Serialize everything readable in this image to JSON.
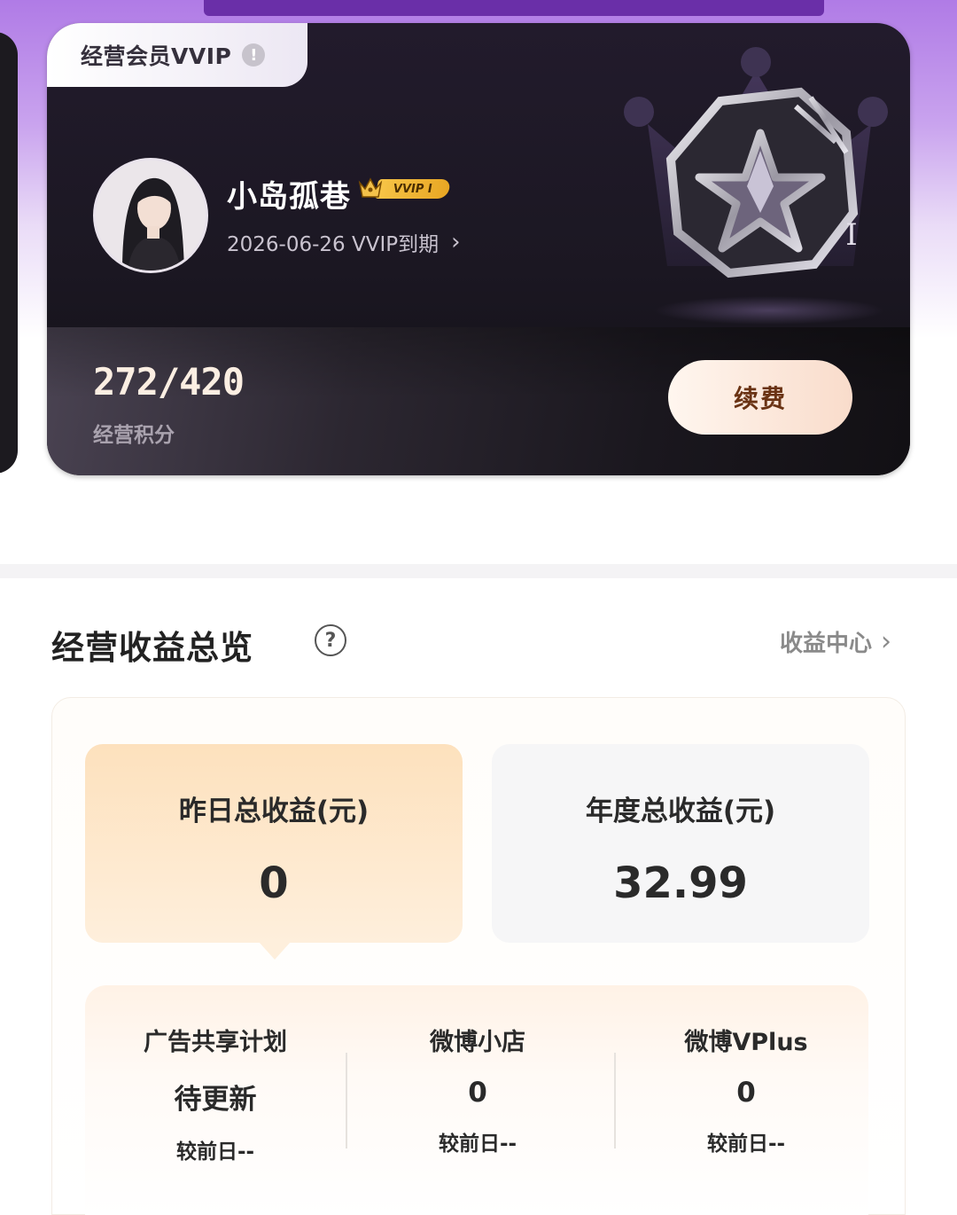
{
  "member_card": {
    "tier_label": "经营会员VVIP",
    "info_icon_glyph": "!",
    "user_name": "小岛孤巷",
    "badge_text": "VVIP I",
    "expiry_text": "2026-06-26  VVIP到期",
    "expiry_arrow": "›",
    "level_mark": "I",
    "points_value": "272/420",
    "points_label": "经营积分",
    "renew_button": "续费"
  },
  "earnings": {
    "title": "经营收益总览",
    "help_glyph": "?",
    "center_link": "收益中心",
    "center_link_arrow": "›",
    "yesterday": {
      "label": "昨日总收益(元)",
      "value": "0"
    },
    "year": {
      "label": "年度总收益(元)",
      "value": "32.99"
    },
    "breakdown": [
      {
        "label": "广告共享计划",
        "value": "待更新",
        "change": "较前日--"
      },
      {
        "label": "微博小店",
        "value": "0",
        "change": "较前日--"
      },
      {
        "label": "微博VPlus",
        "value": "0",
        "change": "较前日--"
      }
    ]
  },
  "colors": {
    "card_dark": "#1b1722",
    "accent_gold": "#f7c548",
    "renew_text": "#6a3314",
    "tile_peach": "#fde1bd"
  },
  "icons": [
    "info-icon",
    "crown-icon",
    "chevron-right-icon",
    "help-icon",
    "star-badge-icon"
  ]
}
